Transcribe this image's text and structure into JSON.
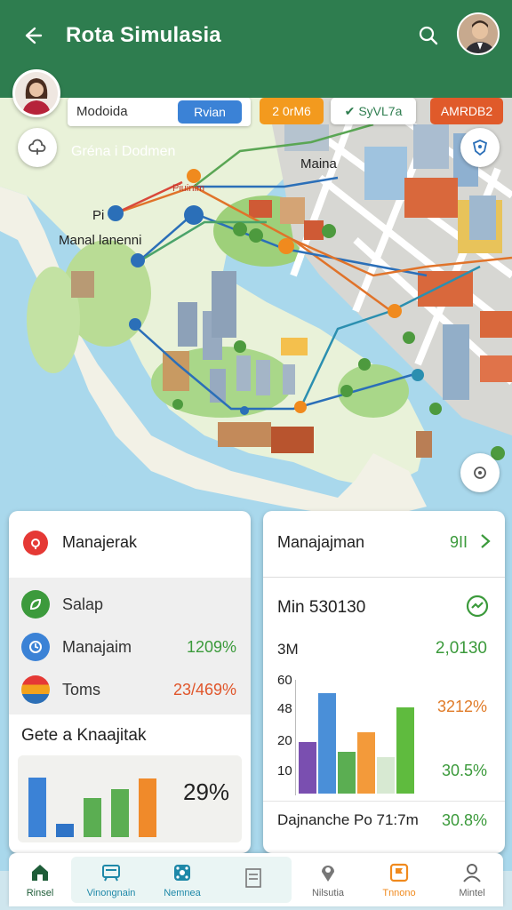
{
  "header": {
    "title": "Rota Simulasia"
  },
  "user": {
    "name": "Gréna i Dodmen"
  },
  "filters": {
    "field_text": "Modoida",
    "chip_blue": "Rvian",
    "chip_orange": "2 0rM6",
    "chip_white": "SyVL7a",
    "chip_red": "AMRDB2"
  },
  "map": {
    "labels": {
      "top": "Maina",
      "dest": "Piuinim",
      "left_a": "Pi",
      "left_b": "Manal lanenni"
    }
  },
  "card_left": {
    "title": "Manajerak",
    "rows": [
      {
        "label": "Salap",
        "value": ""
      },
      {
        "label": "Manajaim",
        "value": "1209%"
      },
      {
        "label": "Toms",
        "value": "23/469%"
      }
    ],
    "subtitle": "Gete a Knaajitak",
    "percent": "29%",
    "bars": [
      {
        "value": 80,
        "color": "#3b82d6"
      },
      {
        "value": 18,
        "color": "#2f74c7"
      },
      {
        "value": 52,
        "color": "#5bae52"
      },
      {
        "value": 64,
        "color": "#5bae52"
      },
      {
        "value": 78,
        "color": "#f08a2a"
      }
    ]
  },
  "card_right": {
    "title": "Manajajman",
    "head_value": "9II",
    "metric": "Min 530130",
    "row_label": "3M",
    "row_value": "2,0130",
    "ticks": [
      "60",
      "48",
      "20",
      "10"
    ],
    "pct_a": "3212%",
    "pct_b": "30.5%",
    "footer_label": "Dajnanche Po 71:7m",
    "footer_value": "30.8%",
    "bars": [
      {
        "value": 45,
        "color": "#7a4fb0"
      },
      {
        "value": 88,
        "color": "#4a8fd8"
      },
      {
        "value": 37,
        "color": "#5bae52"
      },
      {
        "value": 54,
        "color": "#f39a3a"
      },
      {
        "value": 32,
        "color": "#d7e9d2"
      },
      {
        "value": 76,
        "color": "#5fbb3e"
      }
    ]
  },
  "bottom_nav": [
    {
      "label": "Rinsel",
      "icon": "home-icon",
      "color": "#1f5d39"
    },
    {
      "label": "Vinongnain",
      "icon": "bus-icon",
      "color": "#1e88a8"
    },
    {
      "label": "Nemnea",
      "icon": "network-icon",
      "color": "#1e88a8"
    },
    {
      "label": "",
      "icon": "list-icon",
      "color": "#777"
    },
    {
      "label": "Nilsutia",
      "icon": "location-icon",
      "color": "#666"
    },
    {
      "label": "Tnnono",
      "icon": "flag-icon",
      "color": "#f08a1e"
    },
    {
      "label": "Mintel",
      "icon": "user-icon",
      "color": "#666"
    }
  ]
}
